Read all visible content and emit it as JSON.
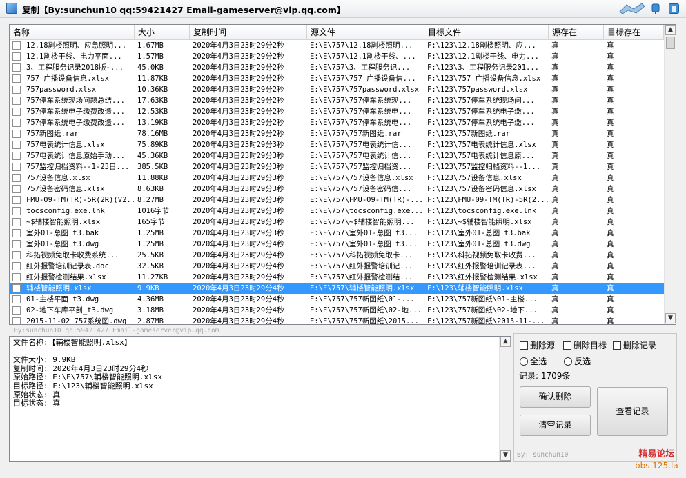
{
  "window": {
    "title": "复制【By:sunchun10 qq:59421427 Email-gameserver@vip.qq.com】"
  },
  "grid": {
    "columns": [
      "名称",
      "大小",
      "复制时间",
      "源文件",
      "目标文件",
      "源存在",
      "目标存在"
    ],
    "selected_row": 22,
    "rows": [
      [
        "12.18副楼照明、应急照明...",
        "1.67MB",
        "2020年4月3日23时29分2秒",
        "E:\\E\\757\\12.18副楼照明...",
        "F:\\123\\12.18副楼照明、应...",
        "真",
        "真"
      ],
      [
        "12.1副楼干线、电力平面...",
        "1.57MB",
        "2020年4月3日23时29分2秒",
        "E:\\E\\757\\12.1副楼干线、...",
        "F:\\123\\12.1副楼干线、电力...",
        "真",
        "真"
      ],
      [
        "3、工程服务记录2018版-...",
        "45.0KB",
        "2020年4月3日23时29分2秒",
        "E:\\E\\757\\3、工程服务记...",
        "F:\\123\\3、工程服务记录201...",
        "真",
        "真"
      ],
      [
        "757 广播设备信息.xlsx",
        "11.87KB",
        "2020年4月3日23时29分2秒",
        "E:\\E\\757\\757 广播设备信...",
        "F:\\123\\757 广播设备信息.xlsx",
        "真",
        "真"
      ],
      [
        "757password.xlsx",
        "10.36KB",
        "2020年4月3日23时29分2秒",
        "E:\\E\\757\\757password.xlsx",
        "F:\\123\\757password.xlsx",
        "真",
        "真"
      ],
      [
        "757停车系统现场问题总结...",
        "17.63KB",
        "2020年4月3日23时29分2秒",
        "E:\\E\\757\\757停车系统现...",
        "F:\\123\\757停车系统现场问...",
        "真",
        "真"
      ],
      [
        "757停车系统电子缴费改造...",
        "12.53KB",
        "2020年4月3日23时29分2秒",
        "E:\\E\\757\\757停车系统电...",
        "F:\\123\\757停车系统电子缴...",
        "真",
        "真"
      ],
      [
        "757停车系统电子缴费改造...",
        "13.19KB",
        "2020年4月3日23时29分2秒",
        "E:\\E\\757\\757停车系统电...",
        "F:\\123\\757停车系统电子缴...",
        "真",
        "真"
      ],
      [
        "757新图纸.rar",
        "78.16MB",
        "2020年4月3日23时29分2秒",
        "E:\\E\\757\\757新图纸.rar",
        "F:\\123\\757新图纸.rar",
        "真",
        "真"
      ],
      [
        "757电表统计信息.xlsx",
        "75.89KB",
        "2020年4月3日23时29分3秒",
        "E:\\E\\757\\757电表统计信...",
        "F:\\123\\757电表统计信息.xlsx",
        "真",
        "真"
      ],
      [
        "757电表统计信息原始手动...",
        "45.36KB",
        "2020年4月3日23时29分3秒",
        "E:\\E\\757\\757电表统计信...",
        "F:\\123\\757电表统计信息原...",
        "真",
        "真"
      ],
      [
        "757监控归档资料--1-23日...",
        "385.5KB",
        "2020年4月3日23时29分3秒",
        "E:\\E\\757\\757监控归档资...",
        "F:\\123\\757监控归档资料--1...",
        "真",
        "真"
      ],
      [
        "757设备信息.xlsx",
        "11.88KB",
        "2020年4月3日23时29分3秒",
        "E:\\E\\757\\757设备信息.xlsx",
        "F:\\123\\757设备信息.xlsx",
        "真",
        "真"
      ],
      [
        "757设备密码信息.xlsx",
        "8.63KB",
        "2020年4月3日23时29分3秒",
        "E:\\E\\757\\757设备密码信...",
        "F:\\123\\757设备密码信息.xlsx",
        "真",
        "真"
      ],
      [
        "FMU-09-TM(TR)-5R(2R)(V2...",
        "8.27MB",
        "2020年4月3日23时29分3秒",
        "E:\\E\\757\\FMU-09-TM(TR)-...",
        "F:\\123\\FMU-09-TM(TR)-5R(2...",
        "真",
        "真"
      ],
      [
        "tocsconfig.exe.lnk",
        "1016字节",
        "2020年4月3日23时29分3秒",
        "E:\\E\\757\\tocsconfig.exe...",
        "F:\\123\\tocsconfig.exe.lnk",
        "真",
        "真"
      ],
      [
        "~$辅楼智能照明.xlsx",
        "165字节",
        "2020年4月3日23时29分3秒",
        "E:\\E\\757\\~$辅楼智能照明...",
        "F:\\123\\~$辅楼智能照明.xlsx",
        "真",
        "真"
      ],
      [
        "室外01-总图_t3.bak",
        "1.25MB",
        "2020年4月3日23时29分3秒",
        "E:\\E\\757\\室外01-总图_t3...",
        "F:\\123\\室外01-总图_t3.bak",
        "真",
        "真"
      ],
      [
        "室外01-总图_t3.dwg",
        "1.25MB",
        "2020年4月3日23时29分4秒",
        "E:\\E\\757\\室外01-总图_t3...",
        "F:\\123\\室外01-总图_t3.dwg",
        "真",
        "真"
      ],
      [
        "科拓视频免取卡收费系统...",
        "25.5KB",
        "2020年4月3日23时29分4秒",
        "E:\\E\\757\\科拓视频免取卡...",
        "F:\\123\\科拓视频免取卡收费...",
        "真",
        "真"
      ],
      [
        "红外报警培训记录表.doc",
        "32.5KB",
        "2020年4月3日23时29分4秒",
        "E:\\E\\757\\红外报警培训记...",
        "F:\\123\\红外报警培训记录表...",
        "真",
        "真"
      ],
      [
        "红外报警检测结果.xlsx",
        "11.27KB",
        "2020年4月3日23时29分4秒",
        "E:\\E\\757\\红外报警检测结...",
        "F:\\123\\红外报警检测结果.xlsx",
        "真",
        "真"
      ],
      [
        "辅楼智能照明.xlsx",
        "9.9KB",
        "2020年4月3日23时29分4秒",
        "E:\\E\\757\\辅楼智能照明.xlsx",
        "F:\\123\\辅楼智能照明.xlsx",
        "真",
        "真"
      ],
      [
        "01-主楼平面_t3.dwg",
        "4.36MB",
        "2020年4月3日23时29分4秒",
        "E:\\E\\757\\757新图纸\\01-...",
        "F:\\123\\757新图纸\\01-主楼...",
        "真",
        "真"
      ],
      [
        "02-地下车库平剖_t3.dwg",
        "3.18MB",
        "2020年4月3日23时29分4秒",
        "E:\\E\\757\\757新图纸\\02-地...",
        "F:\\123\\757新图纸\\02-地下...",
        "真",
        "真"
      ],
      [
        "2015-11-02 757系统图.dwg",
        "2.87MB",
        "2020年4月3日23时29分4秒",
        "E:\\E\\757\\757新图纸\\2015...",
        "F:\\123\\757新图纸\\2015-11-...",
        "真",
        "真"
      ]
    ]
  },
  "status_line": "By:sunchun10 qq:59421427 Email-gameserver@vip.qq.com",
  "details": {
    "lines": [
      "文件名称:【辅楼智能照明.xlsx】",
      "",
      "文件大小: 9.9KB",
      "复制时间: 2020年4月3日23时29分4秒",
      "原始路径: E:\\E\\757\\辅楼智能照明.xlsx",
      "目标路径: F:\\123\\辅楼智能照明.xlsx",
      "原始状态: 真",
      "目标状态: 真"
    ]
  },
  "panel": {
    "delete_source": "删除源",
    "delete_target": "删除目标",
    "delete_record": "删除记录",
    "select_all": "全选",
    "invert_select": "反选",
    "record_count": "记录: 1709条",
    "confirm_delete": "确认删除",
    "clear_records": "清空记录",
    "view_records": "查看记录",
    "credit": "By: sunchun10"
  },
  "watermark": {
    "line1": "精易论坛",
    "line2": "bbs.125.la"
  },
  "colors": {
    "selection": "#3399ff",
    "watermark_red": "#d32f2f",
    "watermark_orange": "#e07700"
  }
}
